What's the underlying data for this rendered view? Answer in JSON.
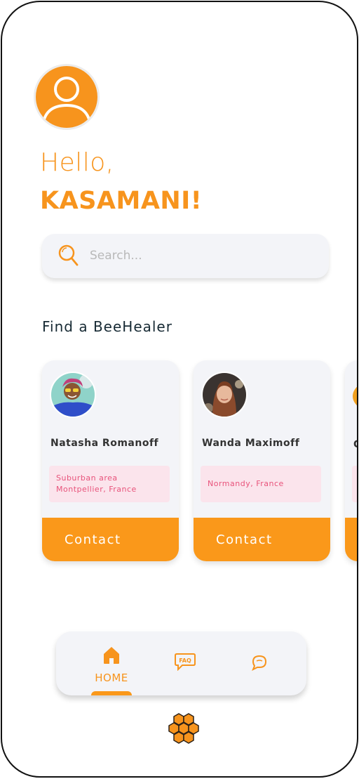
{
  "greeting": {
    "hello": "Hello,",
    "username": "KASAMANI!"
  },
  "search": {
    "placeholder": "Search..."
  },
  "section": {
    "title": "Find a BeeHealer"
  },
  "healers": [
    {
      "name": "Natasha Romanoff",
      "location_line1": "Suburban area",
      "location_line2": "Montpellier, France",
      "contact_label": "Contact"
    },
    {
      "name": "Wanda Maximoff",
      "location_line1": "Normandy, France",
      "location_line2": "",
      "contact_label": "Contact"
    }
  ],
  "partial_card": {
    "name_fragment": "C"
  },
  "nav": {
    "home_label": "HOME",
    "faq_icon_text": "FAQ"
  },
  "colors": {
    "accent": "#f7941d",
    "button": "#fa981a",
    "location_bg": "#fbe4ec",
    "location_text": "#e8537b",
    "card_bg": "#f3f4f8",
    "title": "#172a34"
  },
  "icons": {
    "avatar": "user-silhouette-icon",
    "search": "search-icon",
    "home": "home-icon",
    "faq": "faq-bubble-icon",
    "chat": "chat-bubble-icon",
    "logo": "honeycomb-icon"
  }
}
